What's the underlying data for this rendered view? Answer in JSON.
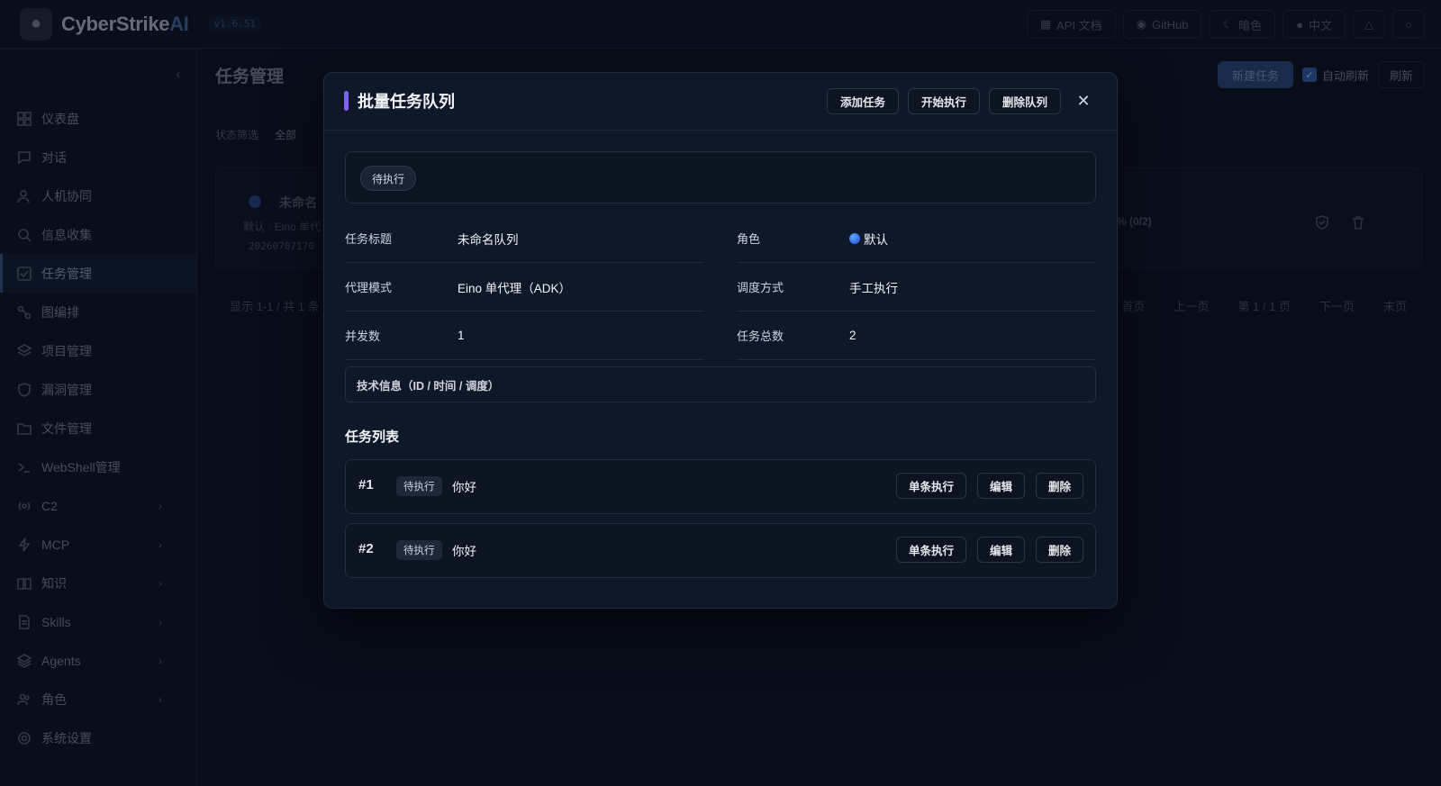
{
  "app": {
    "name_main": "CyberStrike",
    "name_ai": "AI",
    "version": "v1.6.51"
  },
  "topbar": {
    "api_docs": "API 文档",
    "github": "GitHub",
    "theme": "暗色",
    "language": "中文"
  },
  "sidebar": {
    "items": [
      {
        "label": "仪表盘",
        "icon": "dashboard-icon"
      },
      {
        "label": "对话",
        "icon": "chat-icon"
      },
      {
        "label": "人机协同",
        "icon": "user-collab-icon"
      },
      {
        "label": "信息收集",
        "icon": "search-icon"
      },
      {
        "label": "任务管理",
        "icon": "task-check-icon"
      },
      {
        "label": "图编排",
        "icon": "graph-icon"
      },
      {
        "label": "项目管理",
        "icon": "layers-icon"
      },
      {
        "label": "漏洞管理",
        "icon": "shield-icon"
      },
      {
        "label": "文件管理",
        "icon": "folder-icon"
      },
      {
        "label": "WebShell管理",
        "icon": "terminal-icon"
      },
      {
        "label": "C2",
        "icon": "radio-icon"
      },
      {
        "label": "MCP",
        "icon": "bolt-icon"
      },
      {
        "label": "知识",
        "icon": "book-icon"
      },
      {
        "label": "Skills",
        "icon": "document-icon"
      },
      {
        "label": "Agents",
        "icon": "stack-icon"
      },
      {
        "label": "角色",
        "icon": "users-icon"
      },
      {
        "label": "系统设置",
        "icon": "gear-icon"
      }
    ]
  },
  "main": {
    "title": "任务管理",
    "new_task": "新建任务",
    "auto_refresh": "自动刷新",
    "refresh": "刷新",
    "filter_label": "状态筛选",
    "filter_all": "全部",
    "card_name": "未命名",
    "card_sub": "默认 · Eino 单代",
    "card_id": "20260707170",
    "card_progress": "% (0/2)",
    "pager_info": "显示 1-1 / 共 1 条",
    "pager_first": "首页",
    "pager_prev": "上一页",
    "pager_current": "第 1 / 1 页",
    "pager_next": "下一页",
    "pager_last": "末页"
  },
  "modal": {
    "title": "批量任务队列",
    "add_task": "添加任务",
    "start": "开始执行",
    "delete_queue": "删除队列",
    "status": "待执行",
    "fields": {
      "title_label": "任务标题",
      "title_value": "未命名队列",
      "role_label": "角色",
      "role_value": "默认",
      "agent_label": "代理模式",
      "agent_value": "Eino 单代理（ADK）",
      "schedule_label": "调度方式",
      "schedule_value": "手工执行",
      "concurrency_label": "并发数",
      "concurrency_value": "1",
      "total_label": "任务总数",
      "total_value": "2"
    },
    "tech_info": "技术信息（ID / 时间 / 调度）",
    "list_title": "任务列表",
    "tasks": [
      {
        "num": "#1",
        "status": "待执行",
        "text": "你好",
        "run": "单条执行",
        "edit": "编辑",
        "delete": "删除"
      },
      {
        "num": "#2",
        "status": "待执行",
        "text": "你好",
        "run": "单条执行",
        "edit": "编辑",
        "delete": "删除"
      }
    ]
  }
}
